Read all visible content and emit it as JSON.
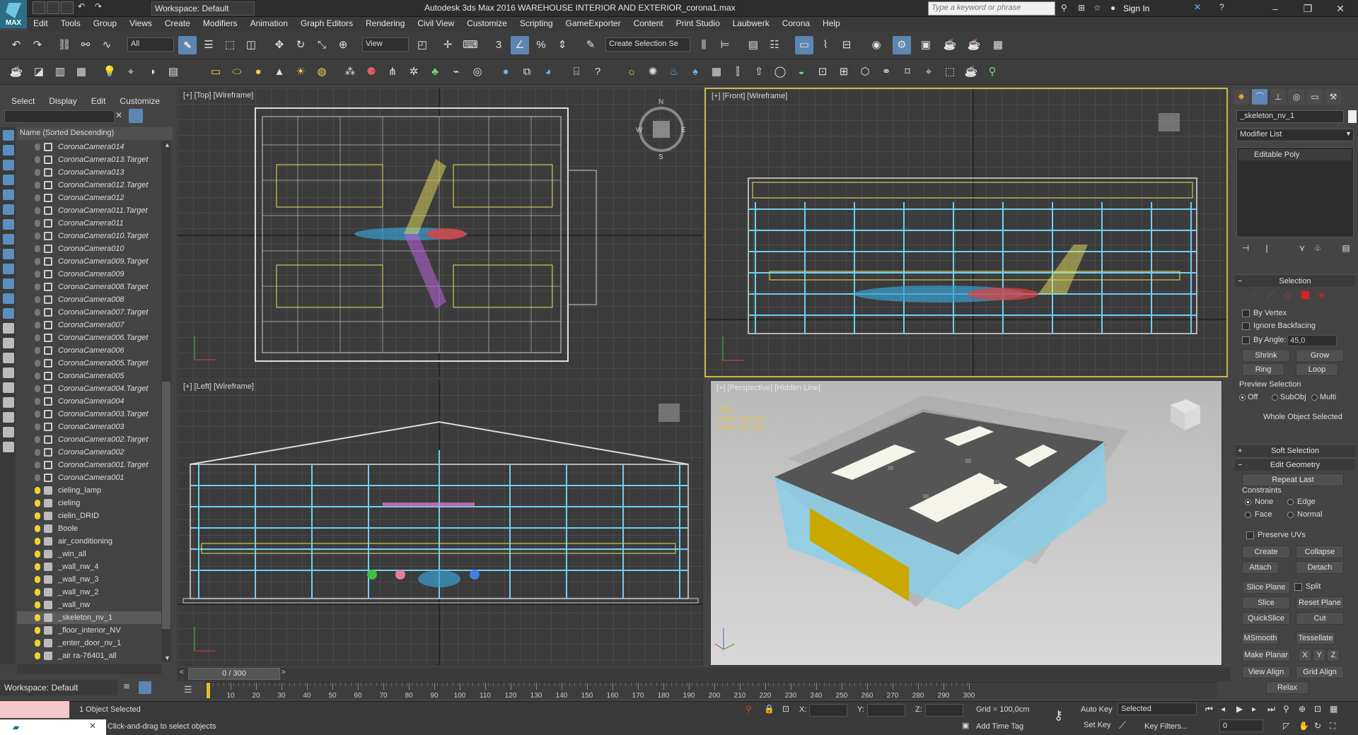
{
  "titlebar": {
    "logo": "MAX",
    "workspace": "Workspace: Default",
    "title": "Autodesk 3ds Max 2016     WAREHOUSE INTERIOR AND EXTERIOR_corona1.max",
    "search_placeholder": "Type a keyword or phrase",
    "signin": "Sign In"
  },
  "menu": [
    "Edit",
    "Tools",
    "Group",
    "Views",
    "Create",
    "Modifiers",
    "Animation",
    "Graph Editors",
    "Rendering",
    "Civil View",
    "Customize",
    "Scripting",
    "GameExporter",
    "Content",
    "Print Studio",
    "Laubwerk",
    "Corona",
    "Help"
  ],
  "toolbar": {
    "filter": "All",
    "ref_coord": "View",
    "selection_set": "Create Selection Se"
  },
  "explorer": {
    "tabs": [
      "Select",
      "Display",
      "Edit",
      "Customize"
    ],
    "header": "Name (Sorted Descending)",
    "rows": [
      {
        "name": "CoronaCamera014",
        "type": "cam"
      },
      {
        "name": "CoronaCamera013.Target",
        "type": "cam"
      },
      {
        "name": "CoronaCamera013",
        "type": "cam"
      },
      {
        "name": "CoronaCamera012.Target",
        "type": "cam"
      },
      {
        "name": "CoronaCamera012",
        "type": "cam"
      },
      {
        "name": "CoronaCamera011.Target",
        "type": "cam"
      },
      {
        "name": "CoronaCamera011",
        "type": "cam"
      },
      {
        "name": "CoronaCamera010.Target",
        "type": "cam"
      },
      {
        "name": "CoronaCamera010",
        "type": "cam"
      },
      {
        "name": "CoronaCamera009.Target",
        "type": "cam"
      },
      {
        "name": "CoronaCamera009",
        "type": "cam"
      },
      {
        "name": "CoronaCamera008.Target",
        "type": "cam"
      },
      {
        "name": "CoronaCamera008",
        "type": "cam"
      },
      {
        "name": "CoronaCamera007.Target",
        "type": "cam"
      },
      {
        "name": "CoronaCamera007",
        "type": "cam"
      },
      {
        "name": "CoronaCamera006.Target",
        "type": "cam"
      },
      {
        "name": "CoronaCamera006",
        "type": "cam"
      },
      {
        "name": "CoronaCamera005.Target",
        "type": "cam"
      },
      {
        "name": "CoronaCamera005",
        "type": "cam"
      },
      {
        "name": "CoronaCamera004.Target",
        "type": "cam"
      },
      {
        "name": "CoronaCamera004",
        "type": "cam"
      },
      {
        "name": "CoronaCamera003.Target",
        "type": "cam"
      },
      {
        "name": "CoronaCamera003",
        "type": "cam"
      },
      {
        "name": "CoronaCamera002.Target",
        "type": "cam"
      },
      {
        "name": "CoronaCamera002",
        "type": "cam"
      },
      {
        "name": "CoronaCamera001.Target",
        "type": "cam"
      },
      {
        "name": "CoronaCamera001",
        "type": "cam"
      },
      {
        "name": "cieling_lamp",
        "type": "geo"
      },
      {
        "name": "cieling",
        "type": "geo"
      },
      {
        "name": "cielin_DRID",
        "type": "geo"
      },
      {
        "name": "Boole",
        "type": "geo"
      },
      {
        "name": "air_conditioning",
        "type": "geo"
      },
      {
        "name": "_win_all",
        "type": "geo"
      },
      {
        "name": "_wall_nw_4",
        "type": "geo"
      },
      {
        "name": "_wall_nw_3",
        "type": "geo"
      },
      {
        "name": "_wall_nw_2",
        "type": "geo"
      },
      {
        "name": "_wall_nw",
        "type": "geo"
      },
      {
        "name": "_skeleton_nv_1",
        "type": "geo",
        "selected": true
      },
      {
        "name": "_floor_interior_NV",
        "type": "geo"
      },
      {
        "name": "_enter_door_nv_1",
        "type": "geo"
      },
      {
        "name": "_air ra-76401_all",
        "type": "geo"
      }
    ]
  },
  "viewports": {
    "top": "[+] [Top] [Wireframe]",
    "front": "[+] [Front] [Wireframe]",
    "left": "[+] [Left] [Wireframe]",
    "persp": "[+] [Perspective] [Hidden Line]",
    "stats": [
      "Total",
      "Polys: 198 443",
      "Verts: 192 034"
    ]
  },
  "command_panel": {
    "object_name": "_skeleton_nv_1",
    "modifier_list": "Modifier List",
    "stack_item": "Editable Poly",
    "selection_title": "Selection",
    "by_vertex": "By Vertex",
    "ignore_backfacing": "Ignore Backfacing",
    "by_angle": "By Angle:",
    "angle_value": "45,0",
    "shrink": "Shrink",
    "grow": "Grow",
    "ring": "Ring",
    "loop": "Loop",
    "preview_selection": "Preview Selection",
    "preview_off": "Off",
    "preview_subobj": "SubObj",
    "preview_multi": "Multi",
    "whole_object": "Whole Object Selected",
    "soft_selection": "Soft Selection",
    "edit_geometry": "Edit Geometry",
    "repeat_last": "Repeat Last",
    "constraints": "Constraints",
    "c_none": "None",
    "c_edge": "Edge",
    "c_face": "Face",
    "c_normal": "Normal",
    "preserve_uvs": "Preserve UVs",
    "create": "Create",
    "collapse": "Collapse",
    "attach": "Attach",
    "detach": "Detach",
    "slice_plane": "Slice Plane",
    "split": "Split",
    "slice": "Slice",
    "reset_plane": "Reset Plane",
    "quickslice": "QuickSlice",
    "cut": "Cut",
    "msmooth": "MSmooth",
    "tessellate": "Tessellate",
    "make_planar": "Make Planar",
    "x": "X",
    "y": "Y",
    "z": "Z",
    "view_align": "View Align",
    "grid_align": "Grid Align",
    "relax": "Relax"
  },
  "timeline": {
    "slider": "0 / 300",
    "ticks": [
      "10",
      "20",
      "30",
      "40",
      "50",
      "60",
      "70",
      "80",
      "90",
      "100",
      "110",
      "120",
      "130",
      "140",
      "150",
      "160",
      "170",
      "180",
      "190",
      "200",
      "210",
      "220",
      "230",
      "240",
      "250",
      "260",
      "270",
      "280",
      "290",
      "300"
    ]
  },
  "status": {
    "workspace": "Workspace: Default",
    "selected": "1 Object Selected",
    "prompt": "Click-and-drag to select objects",
    "x": "X:",
    "y": "Y:",
    "z": "Z:",
    "grid": "Grid = 100,0cm",
    "add_time_tag": "Add Time Tag",
    "auto_key": "Auto Key",
    "set_key": "Set Key",
    "key_mode": "Selected",
    "key_filters": "Key Filters...",
    "frame": "0"
  }
}
